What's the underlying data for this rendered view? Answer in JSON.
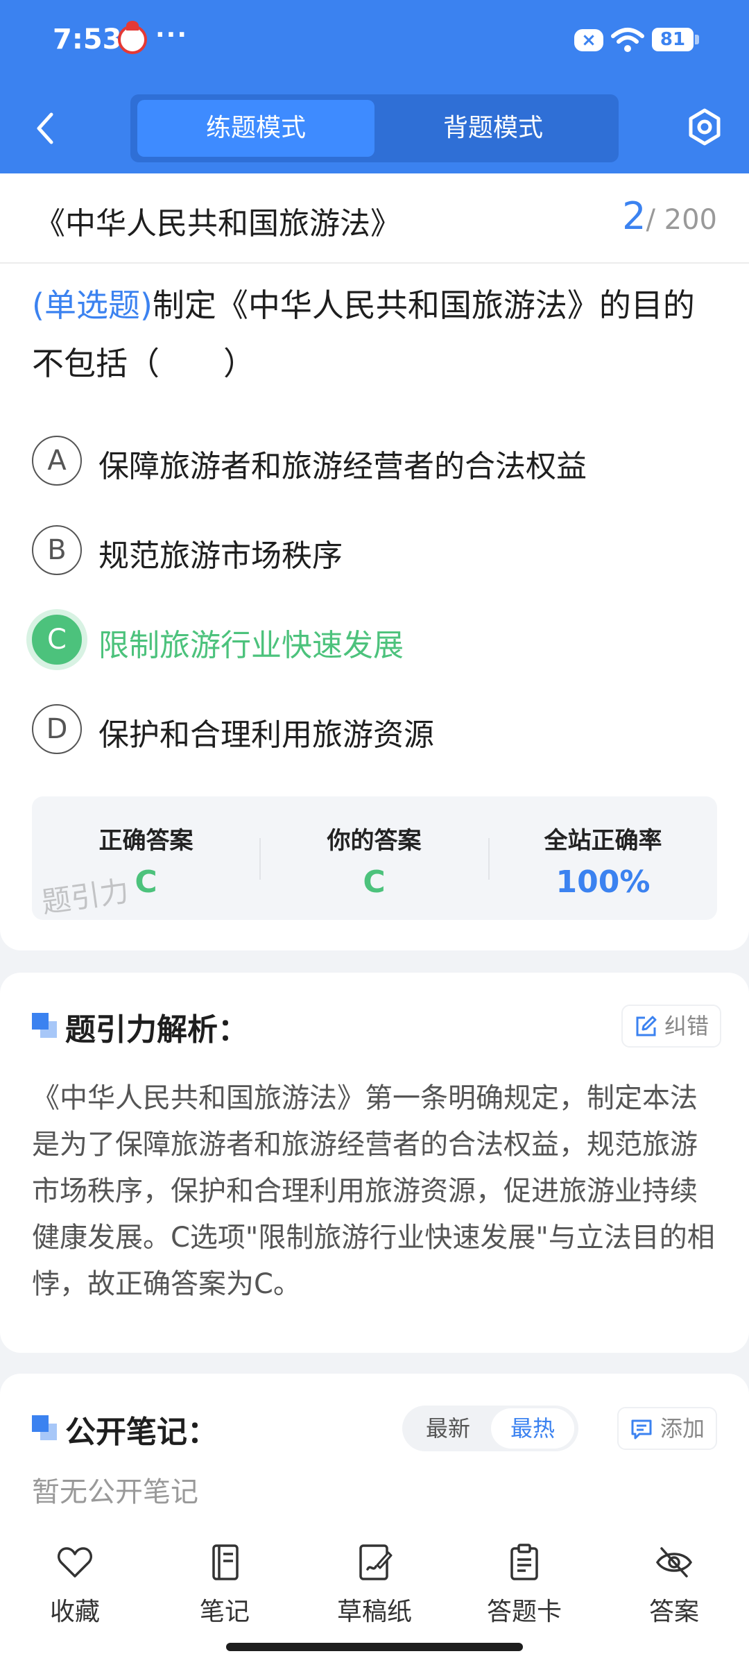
{
  "status_bar": {
    "time": "7:53",
    "dots": "···",
    "battery": "81"
  },
  "header": {
    "mode_tabs": [
      {
        "label": "练题模式",
        "active": true
      },
      {
        "label": "背题模式",
        "active": false
      }
    ]
  },
  "question": {
    "source": "《中华人民共和国旅游法》",
    "current": "2",
    "total": "/ 200",
    "type": "(单选题)",
    "text": "制定《中华人民共和国旅游法》的目的不包括（　　）",
    "options": [
      {
        "letter": "A",
        "text": "保障旅游者和旅游经营者的合法权益",
        "correct": false
      },
      {
        "letter": "B",
        "text": "规范旅游市场秩序",
        "correct": false
      },
      {
        "letter": "C",
        "text": "限制旅游行业快速发展",
        "correct": true
      },
      {
        "letter": "D",
        "text": "保护和合理利用旅游资源",
        "correct": false
      }
    ],
    "stats": [
      {
        "label": "正确答案",
        "value": "C",
        "color": "#4cc27c"
      },
      {
        "label": "你的答案",
        "value": "C",
        "color": "#4cc27c"
      },
      {
        "label": "全站正确率",
        "value": "100%",
        "color": "#3b82f0"
      }
    ],
    "watermark": "题引力"
  },
  "analysis": {
    "title": "题引力解析：",
    "report_label": "纠错",
    "text": "《中华人民共和国旅游法》第一条明确规定，制定本法是为了保障旅游者和旅游经营者的合法权益，规范旅游市场秩序，保护和合理利用旅游资源，促进旅游业持续健康发展。C选项\"限制旅游行业快速发展\"与立法目的相悖，故正确答案为C。"
  },
  "notes": {
    "title": "公开笔记：",
    "sort": [
      "最新",
      "最热"
    ],
    "add_label": "添加",
    "empty": "暂无公开笔记"
  },
  "bottom_nav": [
    {
      "label": "收藏",
      "icon": "heart-icon"
    },
    {
      "label": "笔记",
      "icon": "notebook-icon"
    },
    {
      "label": "草稿纸",
      "icon": "draft-icon"
    },
    {
      "label": "答题卡",
      "icon": "answer-sheet-icon"
    },
    {
      "label": "答案",
      "icon": "eye-off-icon"
    }
  ],
  "colors": {
    "primary": "#3b82f0",
    "correct": "#4cc27c"
  }
}
